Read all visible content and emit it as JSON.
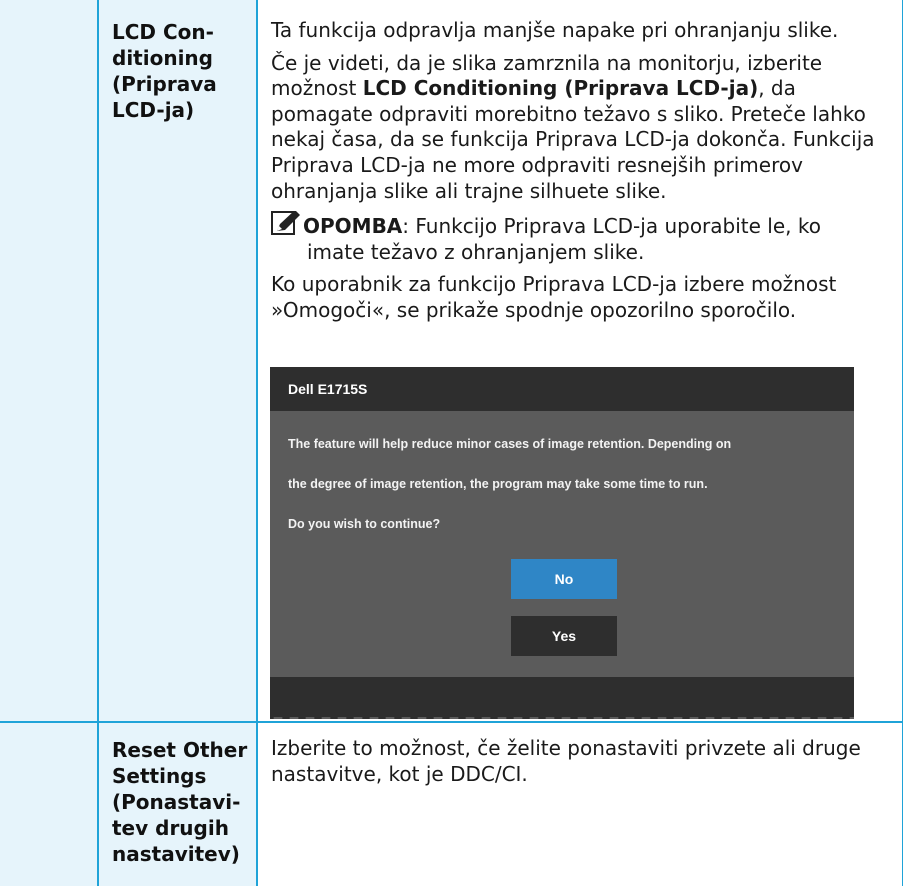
{
  "rows": [
    {
      "term": [
        "LCD Con-",
        "ditioning",
        "(Priprava",
        "LCD-ja)"
      ],
      "desc1": "Ta funkcija odpravlja manjše napake pri ohranjanju slike.",
      "desc2_pre": "Če je videti, da je slika zamrznila na monitorju, izberite možnost ",
      "desc2_bold": "LCD Conditioning (Priprava LCD-ja)",
      "desc2_post": ", da pomagate odpraviti morebitno težavo s sliko. Preteče lahko nekaj časa, da se funkcija Priprava LCD-ja dokonča. Funkcija Priprava LCD-ja ne more odpraviti resnejših primerov ohranjanja slike ali trajne silhuete slike.",
      "note_label": "OPOMBA",
      "note_text": ": Funkcijo Priprava LCD-ja uporabite le, ko",
      "note_text2": "imate težavo z ohranjanjem slike.",
      "desc3": "Ko uporabnik za funkcijo Priprava LCD-ja izbere možnost »Omogoči«, se prikaže spodnje opozorilno sporočilo."
    },
    {
      "term": [
        "Reset Other",
        "Settings",
        "(Ponastavi-",
        "tev drugih",
        "nastavitev)"
      ],
      "desc1": "Izberite to možnost, če želite ponastaviti privzete ali druge nastavitve, kot je DDC/CI."
    }
  ],
  "osd": {
    "title": "Dell E1715S",
    "line1": "The feature will help reduce minor cases of image retention. Depending on",
    "line2": "the degree of image retention, the program may take some time to run.",
    "line3": "Do you wish to continue?",
    "no_label": "No",
    "yes_label": "Yes"
  },
  "icons": {
    "note": "note-pencil-icon"
  },
  "colors": {
    "border": "#1fa3d8",
    "term_bg": "#e6f4fb",
    "osd_bg": "#5b5b5b",
    "osd_dark": "#2e2e2e",
    "btn_blue": "#2f86c6"
  }
}
